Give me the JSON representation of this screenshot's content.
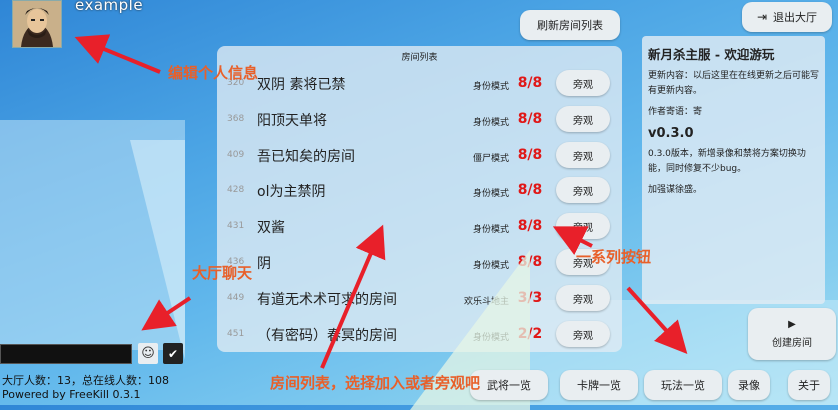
{
  "header": {
    "username": "example",
    "refresh_label": "刷新房间列表",
    "exit_label": "退出大厅"
  },
  "room_list": {
    "title": "房间列表",
    "spectate_label": "旁观",
    "rooms": [
      {
        "id": "320",
        "name": "双阴  素将已禁",
        "mode": "身份模式",
        "count": "8/8"
      },
      {
        "id": "368",
        "name": "阳顶天单将",
        "mode": "身份模式",
        "count": "8/8"
      },
      {
        "id": "409",
        "name": "吾已知矣的房间",
        "mode": "僵尸模式",
        "count": "8/8"
      },
      {
        "id": "428",
        "name": "ol为主禁阴",
        "mode": "身份模式",
        "count": "8/8"
      },
      {
        "id": "431",
        "name": "双酱",
        "mode": "身份模式",
        "count": "8/8"
      },
      {
        "id": "436",
        "name": "阴",
        "mode": "身份模式",
        "count": "8/8"
      },
      {
        "id": "449",
        "name": "有道无术术可求的房间",
        "mode": "欢乐斗地主",
        "count": "3/3"
      },
      {
        "id": "451",
        "name": "（有密码）春冥的房间",
        "mode": "身份模式",
        "count": "2/2"
      }
    ]
  },
  "info_panel": {
    "title": "新月杀主服 - 欢迎游玩",
    "update_text": "更新内容：以后这里在在线更新之后可能写有更新内容。",
    "author_text": "作者寄语：寄",
    "version": "v0.3.0",
    "version_notes": "0.3.0版本，新增录像和禁将方案切换功能，同时修复不少bug。",
    "extra_note": "加强谋徐盛。"
  },
  "actions": {
    "create_room_label": "创建房间",
    "general_overview_label": "武将一览",
    "card_overview_label": "卡牌一览",
    "mode_overview_label": "玩法一览",
    "replay_label": "录像",
    "about_label": "关于"
  },
  "chat": {
    "input_value": "",
    "emoji_icon": "smiley-icon",
    "send_icon": "checkmark-icon"
  },
  "footer": {
    "lobby_stats": "大厅人数：13，总在线人数：108",
    "powered_by": "Powered by FreeKill 0.3.1"
  },
  "annotations": {
    "profile": "编辑个人信息",
    "lobby_chat": "大厅聊天",
    "buttons": "一系列按钮",
    "room_list": "房间列表，选择加入或者旁观吧"
  },
  "colors": {
    "annotation": "#e8602a",
    "player_count": "#e01818"
  }
}
